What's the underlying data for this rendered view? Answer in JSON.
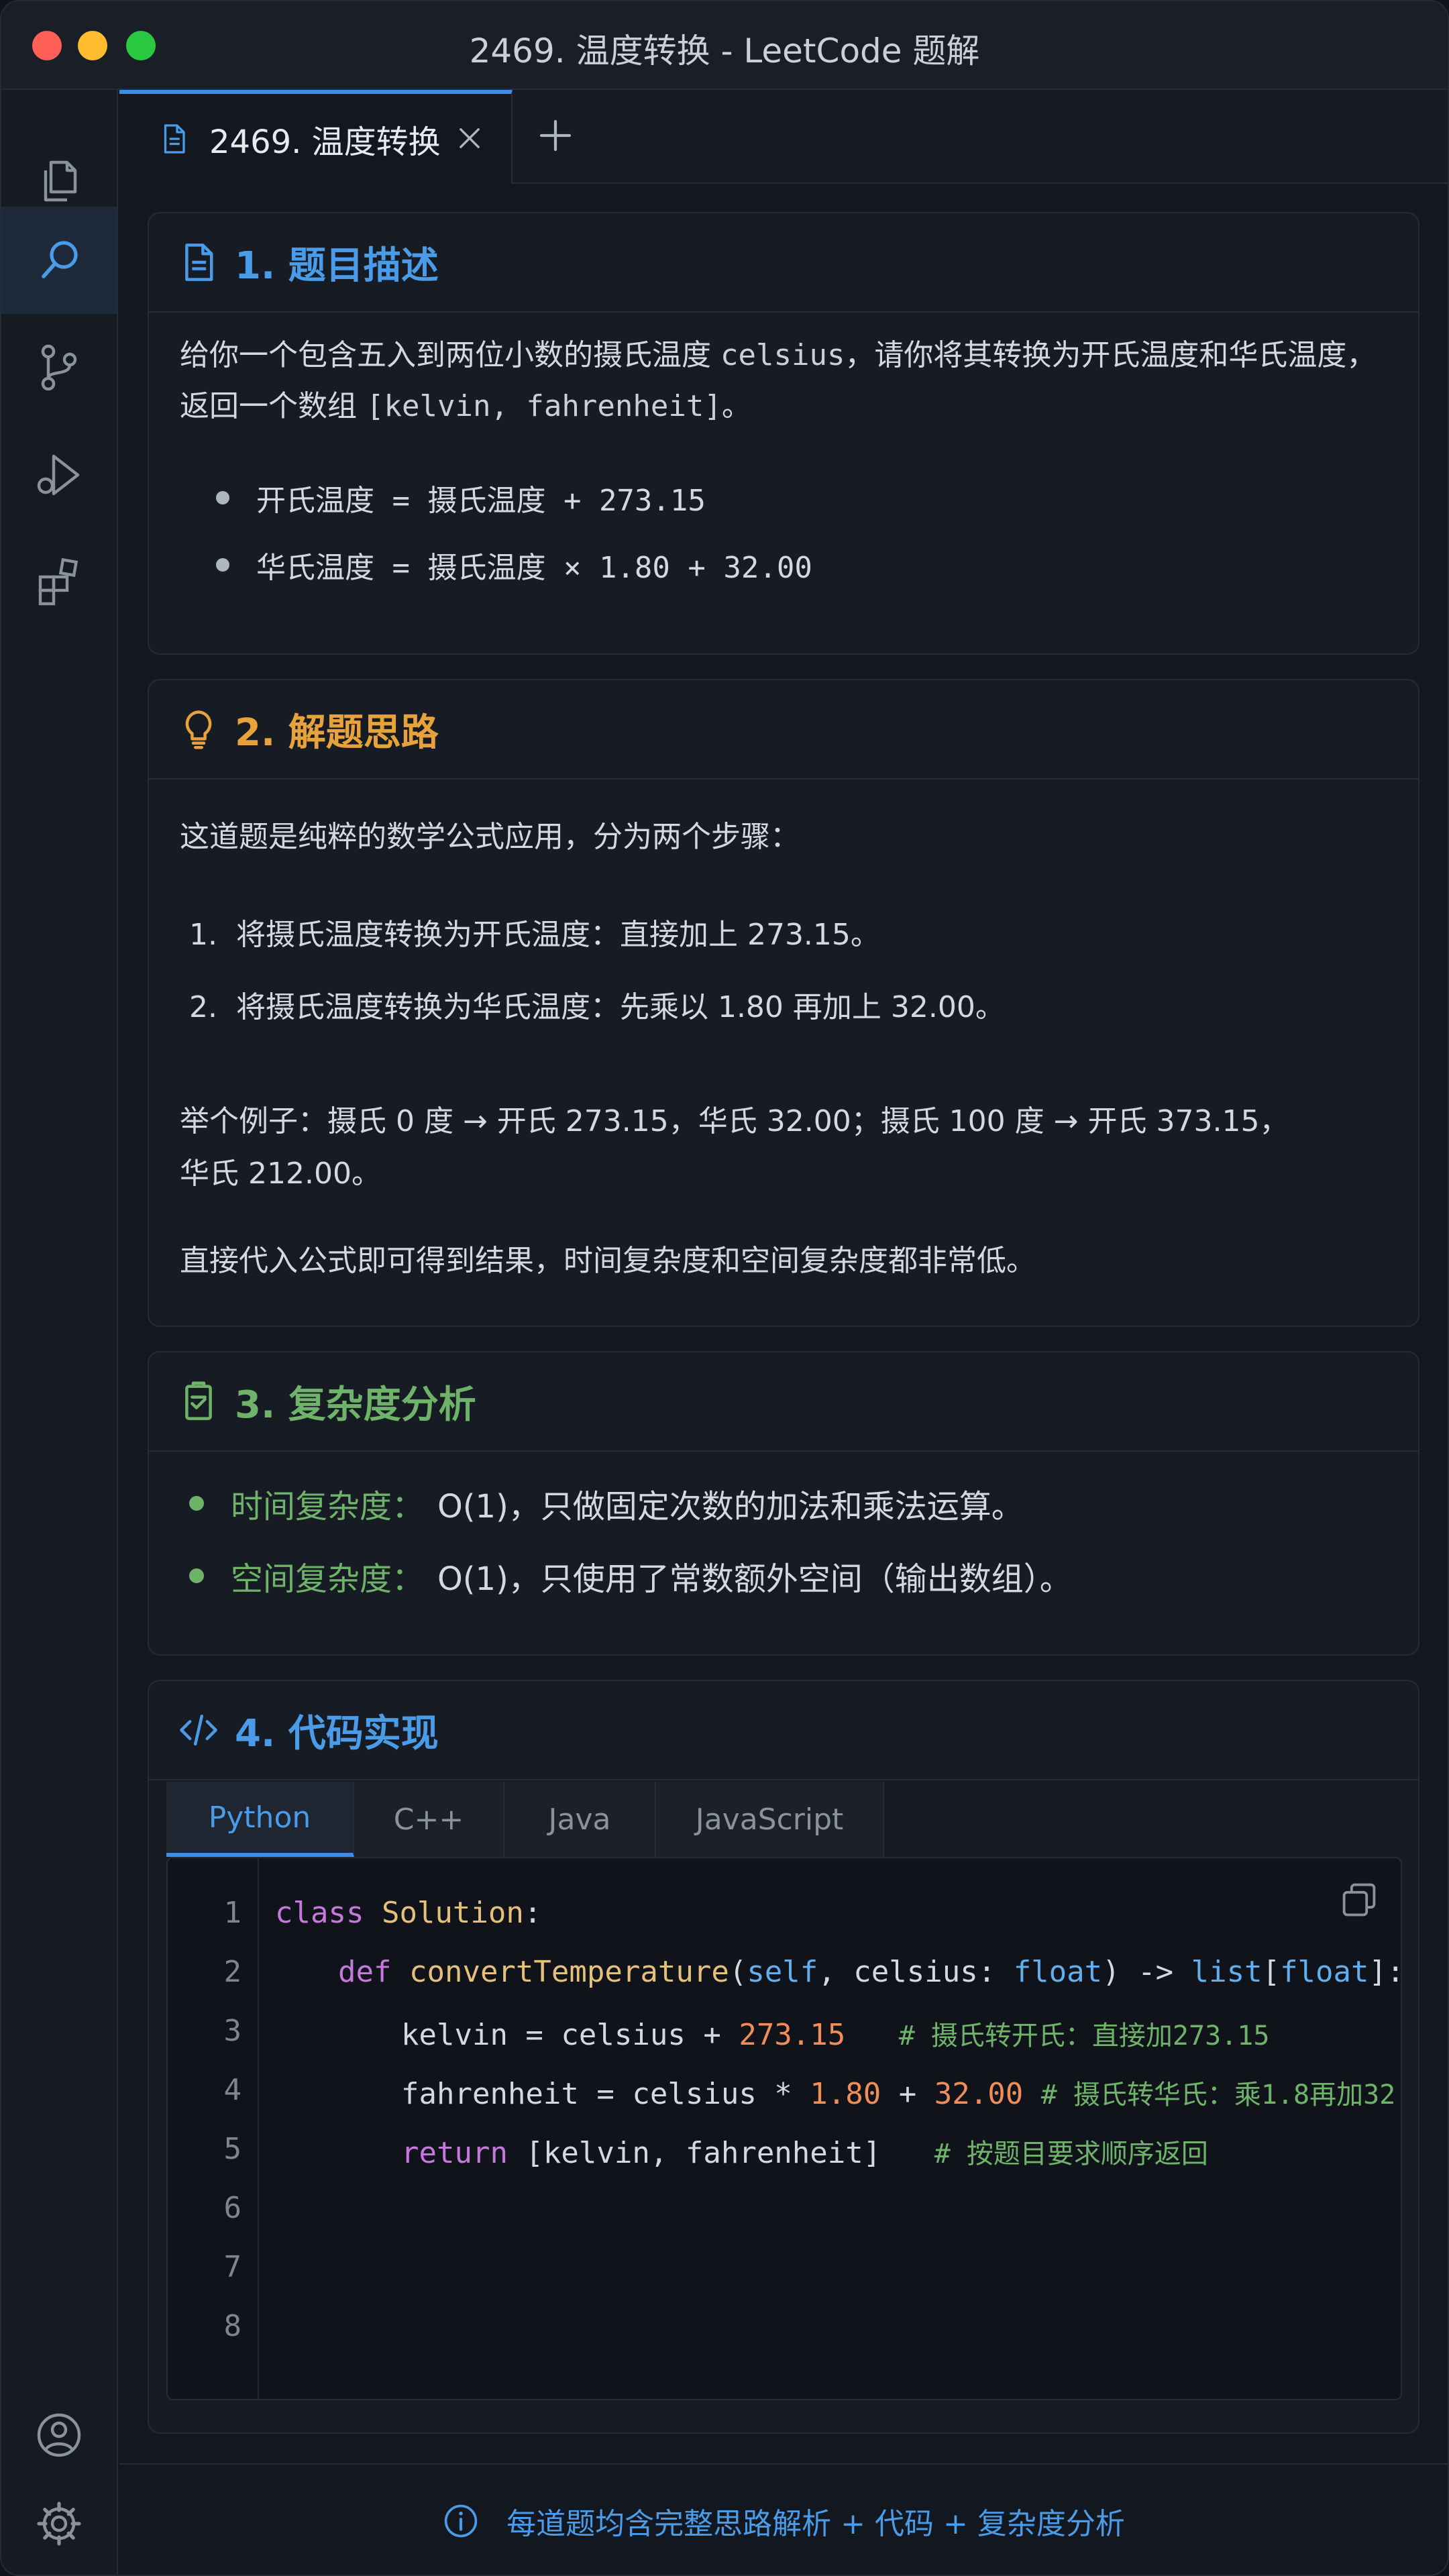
{
  "window": {
    "title": "2469. 温度转换 - LeetCode 题解"
  },
  "editor": {
    "tab_label": "2469. 温度转换"
  },
  "section1": {
    "title": "1. 题目描述",
    "desc_part1": "给你一个包含五入到两位小数的摄氏温度 ",
    "desc_code1": "celsius",
    "desc_part2": "，请你将其转换为开氏温度和华氏温度，",
    "desc_part3": "返回一个数组 ",
    "desc_code2": "[kelvin, fahrenheit]",
    "desc_part4": "。",
    "bullets": [
      "开氏温度 = 摄氏温度 + 273.15",
      "华氏温度 = 摄氏温度 × 1.80 + 32.00"
    ]
  },
  "section2": {
    "title": "2. 解题思路",
    "intro": "这道题是纯粹的数学公式应用，分为两个步骤：",
    "steps": [
      "将摄氏温度转换为开氏温度：直接加上 273.15。",
      "将摄氏温度转换为华氏温度：先乘以 1.80 再加上 32.00。"
    ],
    "step_numbers": [
      "1.",
      "2."
    ],
    "example_line1": "举个例子：摄氏 0 度 → 开氏 273.15，华氏 32.00；摄氏 100 度  → 开氏 373.15，",
    "example_line2": "华氏 212.00。",
    "conclusion": "直接代入公式即可得到结果，时间复杂度和空间复杂度都非常低。"
  },
  "section3": {
    "title": "3. 复杂度分析",
    "time_label": "时间复杂度：",
    "time_value": "O(1)，只做固定次数的加法和乘法运算。",
    "space_label": "空间复杂度：",
    "space_value": "O(1)，只使用了常数额外空间（输出数组）。"
  },
  "section4": {
    "title": "4. 代码实现",
    "lang_tabs": [
      "Python",
      "C++",
      "Java",
      "JavaScript"
    ],
    "active_lang": "Python",
    "line_numbers": [
      "1",
      "2",
      "3",
      "4",
      "5",
      "6",
      "7",
      "8"
    ],
    "code": {
      "l1_kw": "class",
      "l1_name": "Solution",
      "l1_rest": ":",
      "l2_kw": "def",
      "l2_fn": "convertTemperature",
      "l2_p1": "(",
      "l2_self": "self",
      "l2_p2": ", celsius: ",
      "l2_float1": "float",
      "l2_p3": ") -> ",
      "l2_list": "list",
      "l2_p4": "[",
      "l2_float2": "float",
      "l2_p5": "]:",
      "l3_a": "kelvin = celsius + ",
      "l3_num": "273.15",
      "l3_cm": "# 摄氏转开氏：直接加273.15",
      "l4_a": "fahrenheit = celsius * ",
      "l4_num1": "1.80",
      "l4_b": " + ",
      "l4_num2": "32.00",
      "l4_cm": "# 摄氏转华氏：乘1.8再加32",
      "l5_kw": "return",
      "l5_a": " [kelvin, fahrenheit]",
      "l5_cm": "# 按题目要求顺序返回"
    }
  },
  "footer": {
    "text": "每道题均含完整思路解析 + 代码 + 复杂度分析"
  },
  "colors": {
    "accent": "#3b8fe8",
    "section_blue": "#4a9be8",
    "section_orange": "#e8a23c",
    "section_green": "#6fb36a"
  },
  "icons": [
    "files-icon",
    "search-icon",
    "source-control-icon",
    "run-debug-icon",
    "extensions-icon",
    "account-icon",
    "settings-icon",
    "file-icon",
    "close-icon",
    "plus-icon",
    "document-icon",
    "lightbulb-icon",
    "clipboard-check-icon",
    "code-icon",
    "copy-icon",
    "info-icon"
  ]
}
